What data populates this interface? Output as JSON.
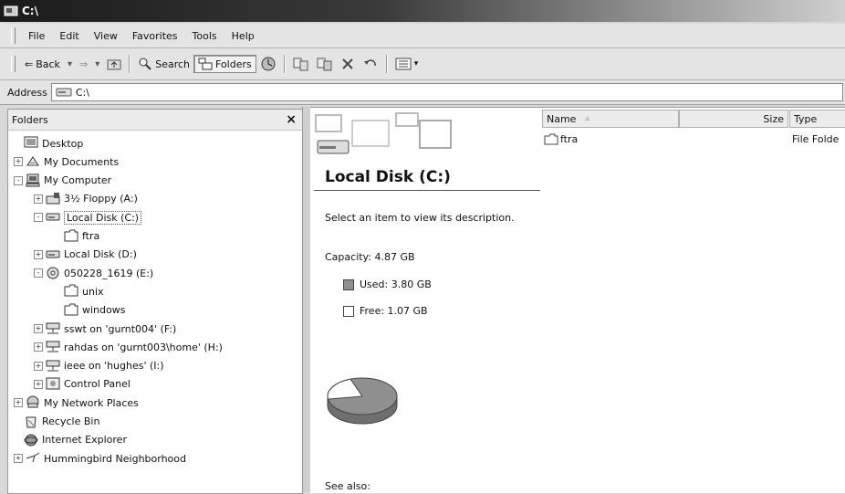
{
  "window": {
    "title": "C:\\"
  },
  "menu": [
    "File",
    "Edit",
    "View",
    "Favorites",
    "Tools",
    "Help"
  ],
  "toolbar": {
    "back": "Back",
    "search": "Search",
    "folders": "Folders"
  },
  "address": {
    "label": "Address",
    "value": "C:\\"
  },
  "folders_pane": {
    "title": "Folders",
    "close": "×",
    "tree": [
      {
        "label": "Desktop",
        "icon": "desktop-icon",
        "expander": ""
      },
      {
        "label": "My Documents",
        "icon": "my-documents-icon",
        "expander": "+"
      },
      {
        "label": "My Computer",
        "icon": "my-computer-icon",
        "expander": "−"
      },
      {
        "label": "3½ Floppy (A:)",
        "icon": "floppy-drive-icon",
        "expander": "+"
      },
      {
        "label": "Local Disk (C:)",
        "icon": "hard-drive-icon",
        "expander": "−",
        "selected": true
      },
      {
        "label": "ftra",
        "icon": "folder-icon",
        "expander": ""
      },
      {
        "label": "Local Disk (D:)",
        "icon": "hard-drive-icon",
        "expander": "+"
      },
      {
        "label": "050228_1619 (E:)",
        "icon": "cd-drive-icon",
        "expander": "−"
      },
      {
        "label": "unix",
        "icon": "folder-icon",
        "expander": ""
      },
      {
        "label": "windows",
        "icon": "folder-icon",
        "expander": ""
      },
      {
        "label": "sswt on 'gurnt004' (F:)",
        "icon": "network-drive-icon",
        "expander": "+"
      },
      {
        "label": "rahdas on 'gurnt003\\home' (H:)",
        "icon": "network-drive-icon",
        "expander": "+"
      },
      {
        "label": "ieee on 'hughes' (I:)",
        "icon": "network-drive-icon",
        "expander": "+"
      },
      {
        "label": "Control Panel",
        "icon": "control-panel-icon",
        "expander": "+"
      },
      {
        "label": "My Network Places",
        "icon": "network-places-icon",
        "expander": "+"
      },
      {
        "label": "Recycle Bin",
        "icon": "recycle-bin-icon",
        "expander": ""
      },
      {
        "label": "Internet Explorer",
        "icon": "internet-explorer-icon",
        "expander": ""
      },
      {
        "label": "Hummingbird Neighborhood",
        "icon": "hummingbird-icon",
        "expander": "+"
      }
    ]
  },
  "webview": {
    "drive_title": "Local Disk (C:)",
    "description": "Select an item to view its description.",
    "capacity": "Capacity: 4.87 GB",
    "used": "Used: 3.80 GB",
    "free": "Free: 1.07 GB",
    "used_fraction": 0.78,
    "see_also": "See also:",
    "colors": {
      "used": "#8f8f8f",
      "free": "#ffffff"
    }
  },
  "details": {
    "columns": {
      "name": "Name",
      "size": "Size",
      "type": "Type"
    },
    "rows": [
      {
        "name": "ftra",
        "size": "",
        "type": "File Folde"
      }
    ]
  }
}
